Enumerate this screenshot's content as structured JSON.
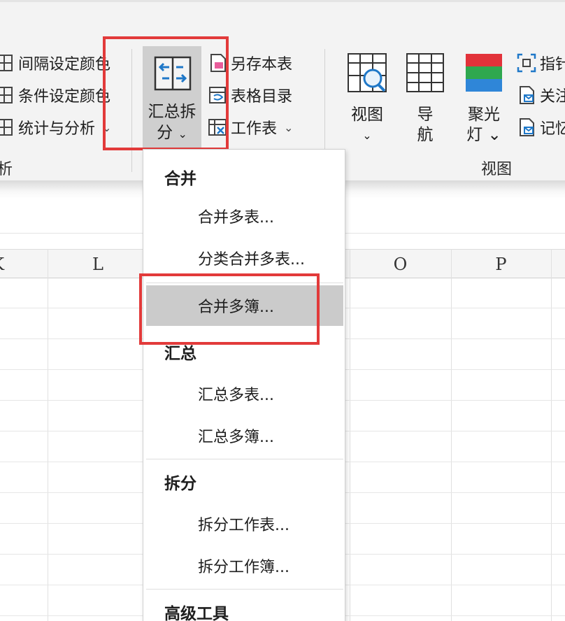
{
  "ribbon": {
    "analysis_group": {
      "items": [
        {
          "label": "间隔设定颜色",
          "icon": "table-color-icon"
        },
        {
          "label": "条件设定颜色",
          "icon": "table-condition-icon"
        },
        {
          "label": "统计与分析",
          "icon": "table-stats-icon",
          "dropdown": "⌄"
        }
      ],
      "group_label": "析"
    },
    "summary_button": {
      "line1": "汇总拆",
      "line2": "分",
      "dropdown": "⌄",
      "icon": "merge-arrows-icon"
    },
    "sheet_group": {
      "items": [
        {
          "label": "另存本表",
          "icon": "save-sheet-icon"
        },
        {
          "label": "表格目录",
          "icon": "table-directory-icon"
        },
        {
          "label": "工作表",
          "icon": "worksheet-icon",
          "dropdown": "⌄"
        }
      ]
    },
    "view_group": {
      "buttons": [
        {
          "line1": "视图",
          "line2": "⌄",
          "icon": "view-magnifier-icon"
        },
        {
          "line1": "导",
          "line2": "航",
          "icon": "grid-navigation-icon"
        },
        {
          "line1": "聚光",
          "line2": "灯 ⌄",
          "icon": "spotlight-icon"
        }
      ],
      "side_items": [
        {
          "label": "指针",
          "icon": "pointer-frame-icon"
        },
        {
          "label": "关注",
          "icon": "follow-doc-icon"
        },
        {
          "label": "记忆",
          "icon": "memory-doc-icon"
        }
      ],
      "group_label": "视图"
    },
    "colors": {
      "spot_red": "#e2323a",
      "spot_green": "#2fa84f",
      "spot_blue": "#2f86d8",
      "accent_blue": "#1f78c8",
      "highlight": "#e23a3a"
    }
  },
  "grid": {
    "columns": [
      "K",
      "L",
      "O",
      "P"
    ]
  },
  "menu": {
    "sections": [
      {
        "heading": "合并",
        "items": [
          "合并多表...",
          "分类合并多表...",
          "合并多簿..."
        ]
      },
      {
        "heading": "汇总",
        "items": [
          "汇总多表...",
          "汇总多簿..."
        ]
      },
      {
        "heading": "拆分",
        "items": [
          "拆分工作表...",
          "拆分工作簿..."
        ]
      },
      {
        "heading": "高级工具",
        "items": []
      }
    ],
    "selected_item": "合并多簿..."
  }
}
